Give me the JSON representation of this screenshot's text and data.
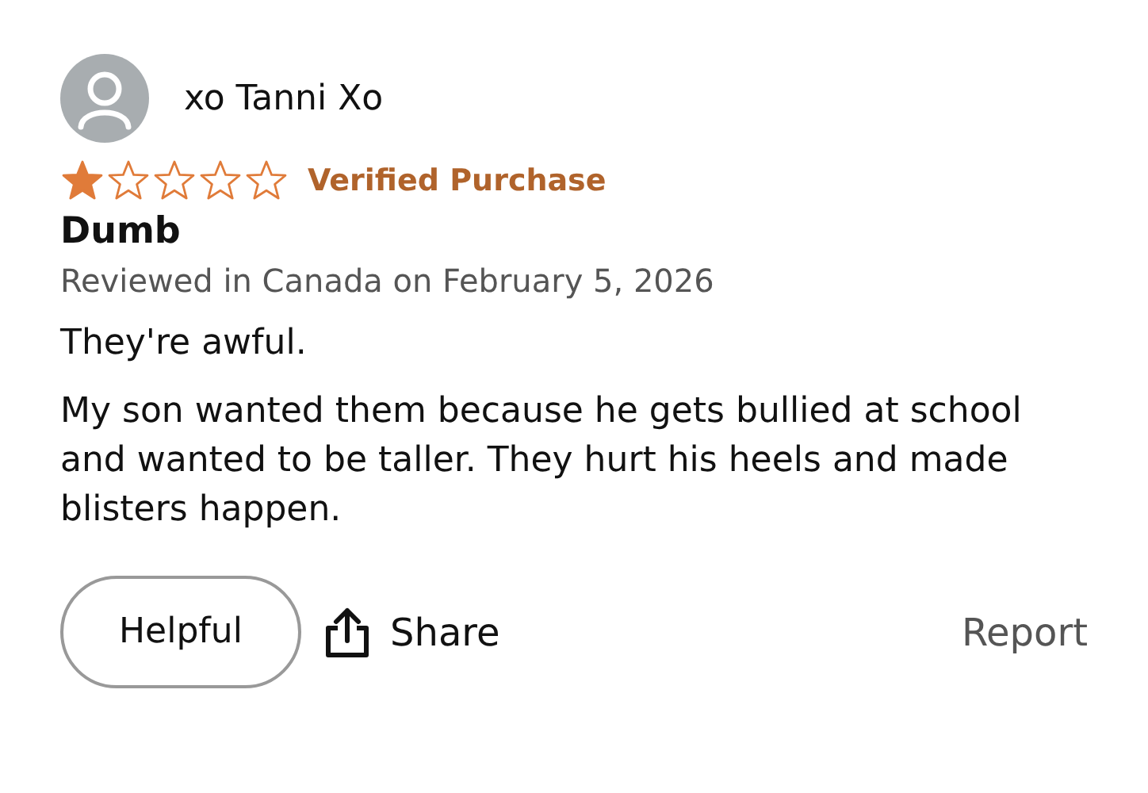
{
  "review": {
    "author": "xo Tanni Xo",
    "stars": 1,
    "badge": "Verified Purchase",
    "title": "Dumb",
    "meta": "Reviewed in Canada on February 5, 2026",
    "paragraphs": [
      "They're awful.",
      "My son wanted them because he gets bullied at school and wanted to be taller. They hurt his heels and made blisters happen."
    ]
  },
  "actions": {
    "helpful": "Helpful",
    "share": "Share",
    "report": "Report"
  }
}
